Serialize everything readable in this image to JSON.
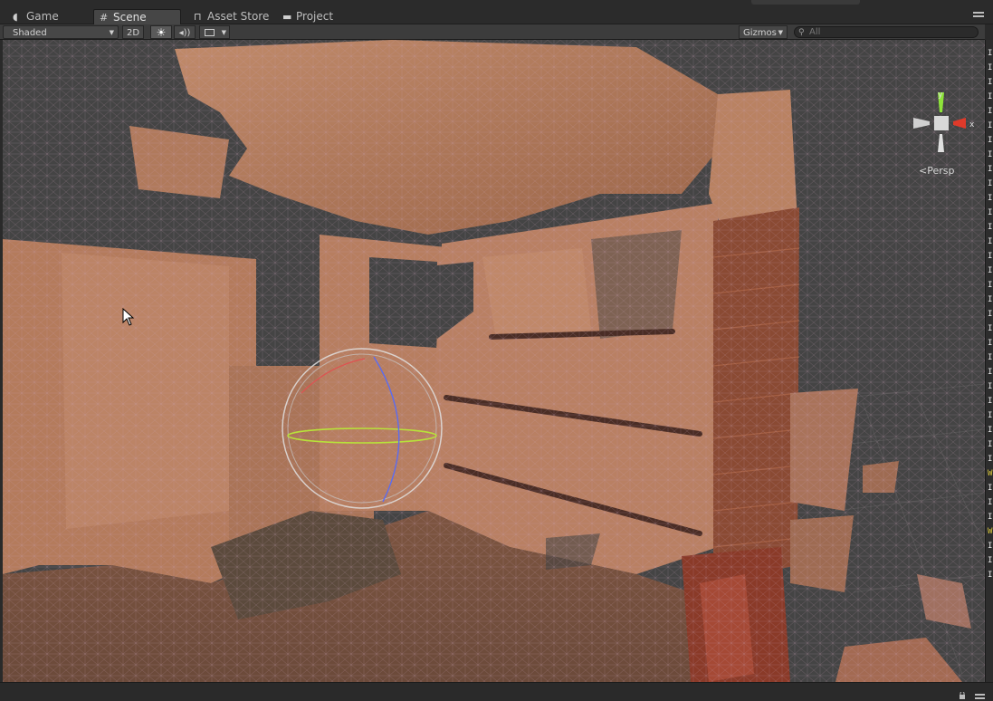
{
  "tabs": [
    {
      "label": "Game",
      "icon": "pacman-icon"
    },
    {
      "label": "Scene",
      "icon": "grid-icon",
      "active": true
    },
    {
      "label": "Asset Store",
      "icon": "bag-icon"
    },
    {
      "label": "Project",
      "icon": "folder-icon"
    }
  ],
  "toolbar": {
    "draw_mode": "Shaded",
    "btn_2d": "2D",
    "light_glyph": "☀",
    "audio_glyph": "◂))",
    "gizmos_label": "Gizmos",
    "search_placeholder": "All"
  },
  "scene": {
    "projection_label": "Persp",
    "axis_y": "y",
    "axis_x": "x"
  },
  "console_lines": [
    "I",
    "I",
    "I",
    "I",
    "I",
    "I",
    "I",
    "I",
    "I",
    "I",
    "I",
    "I",
    "I",
    "I",
    "I",
    "I",
    "I",
    "I",
    "I",
    "I",
    "I",
    "I",
    "I",
    "I",
    "I",
    "I",
    "I",
    "I",
    "I",
    "W",
    "I",
    "I",
    "I",
    "W",
    "I",
    "I",
    "I"
  ],
  "colors": {
    "background": "#444444",
    "mesh": "#b07556",
    "axis_y": "#8ee43a",
    "axis_x": "#e03a2a",
    "warning": "#d8c63c"
  }
}
